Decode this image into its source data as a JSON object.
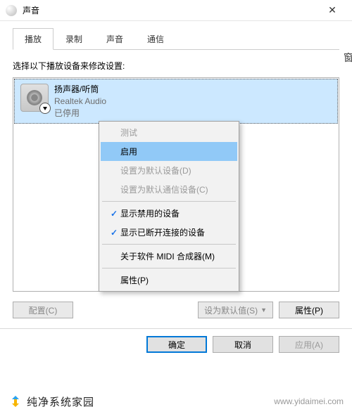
{
  "titlebar": {
    "title": "声音"
  },
  "tabs": [
    {
      "label": "播放",
      "active": true
    },
    {
      "label": "录制",
      "active": false
    },
    {
      "label": "声音",
      "active": false
    },
    {
      "label": "通信",
      "active": false
    }
  ],
  "instruction": "选择以下播放设备来修改设置:",
  "device": {
    "name": "扬声器/听筒",
    "driver": "Realtek Audio",
    "status": "已停用"
  },
  "context_menu": {
    "groups": [
      [
        {
          "label": "测试",
          "state": "disabled"
        },
        {
          "label": "启用",
          "state": "highlight"
        },
        {
          "label": "设置为默认设备(D)",
          "state": "disabled",
          "accel": "D"
        },
        {
          "label": "设置为默认通信设备(C)",
          "state": "disabled",
          "accel": "C"
        }
      ],
      [
        {
          "label": "显示禁用的设备",
          "state": "enabled",
          "checked": true
        },
        {
          "label": "显示已断开连接的设备",
          "state": "enabled",
          "checked": true
        }
      ],
      [
        {
          "label": "关于软件 MIDI 合成器(M)",
          "state": "enabled",
          "accel": "M"
        }
      ],
      [
        {
          "label": "属性(P)",
          "state": "enabled",
          "accel": "P"
        }
      ]
    ]
  },
  "buttons": {
    "configure": "配置(C)",
    "set_default": "设为默认值(S)",
    "properties": "属性(P)",
    "ok": "确定",
    "cancel": "取消",
    "apply": "应用(A)"
  },
  "brand": {
    "text": "纯净系统家园",
    "url": "www.yidaimei.com"
  },
  "side_cut": "窗"
}
